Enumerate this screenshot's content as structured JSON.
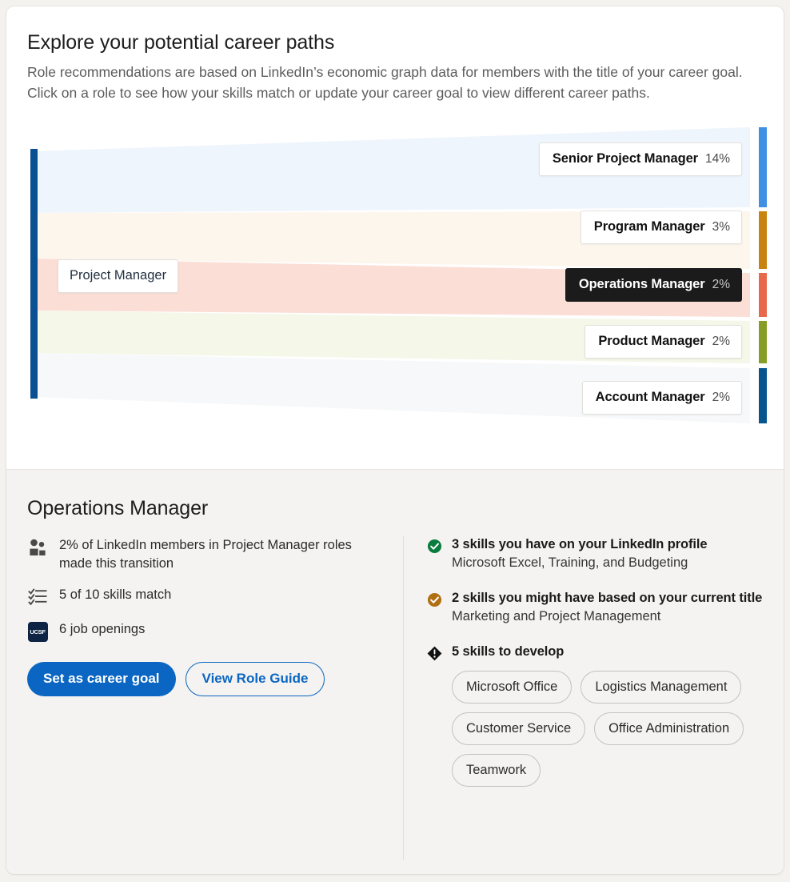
{
  "header": {
    "title": "Explore your potential career paths",
    "subtitle": "Role recommendations are based on LinkedIn’s economic graph data for members with the title of your career goal. Click on a role to see how your skills match or update your career goal to view different career paths."
  },
  "chart_data": {
    "type": "sankey",
    "title": "Explore your potential career paths",
    "source": {
      "label": "Project Manager",
      "color": "#0a5193"
    },
    "categories": [
      "Senior Project Manager",
      "Program Manager",
      "Operations Manager",
      "Product Manager",
      "Account Manager"
    ],
    "values": [
      14,
      3,
      2,
      2,
      2
    ],
    "value_labels": [
      "14%",
      "3%",
      "2%",
      "2%",
      "2%"
    ],
    "selected": "Operations Manager",
    "nodes": [
      {
        "label": "Senior Project Manager",
        "percent": "14%",
        "value": 14,
        "color": "#3f90e3",
        "ribbon": "#eef5fc",
        "selected": false
      },
      {
        "label": "Program Manager",
        "percent": "3%",
        "value": 3,
        "color": "#c98310",
        "ribbon": "#fdf6ec",
        "selected": false
      },
      {
        "label": "Operations Manager",
        "percent": "2%",
        "value": 2,
        "color": "#e7684a",
        "ribbon": "#fbdfd7",
        "selected": true
      },
      {
        "label": "Product Manager",
        "percent": "2%",
        "value": 2,
        "color": "#869d27",
        "ribbon": "#f5f7e9",
        "selected": false
      },
      {
        "label": "Account Manager",
        "percent": "2%",
        "value": 2,
        "color": "#08548f",
        "ribbon": "#f6f8fa",
        "selected": false
      }
    ]
  },
  "detail": {
    "title": "Operations Manager",
    "stats": [
      {
        "icon": "people-icon",
        "text": "2% of LinkedIn members in Project Manager roles made this transition"
      },
      {
        "icon": "checklist-icon",
        "text": "5 of 10 skills match"
      },
      {
        "icon": "ucsf-logo-icon",
        "text": "6 job openings",
        "badge": "UCSF"
      }
    ],
    "buttons": {
      "primary": "Set as career goal",
      "secondary": "View Role Guide"
    },
    "skills": [
      {
        "icon": "check-circle-green-icon",
        "color": "#0a7b3e",
        "heading": "3 skills you have on your LinkedIn profile",
        "sub": "Microsoft Excel, Training, and Budgeting"
      },
      {
        "icon": "check-circle-amber-icon",
        "color": "#b07012",
        "heading": "2 skills you might have based on your current title",
        "sub": "Marketing and Project Management"
      },
      {
        "icon": "alert-diamond-icon",
        "color": "#111111",
        "heading": "5 skills to develop",
        "sub": ""
      }
    ],
    "develop_pills": [
      "Microsoft Office",
      "Logistics Management",
      "Customer Service",
      "Office Administration",
      "Teamwork"
    ]
  },
  "colors": {
    "brand_blue": "#0a66c2",
    "selected_dark": "#1b1b1b",
    "panel_bg": "#f4f3f1"
  }
}
